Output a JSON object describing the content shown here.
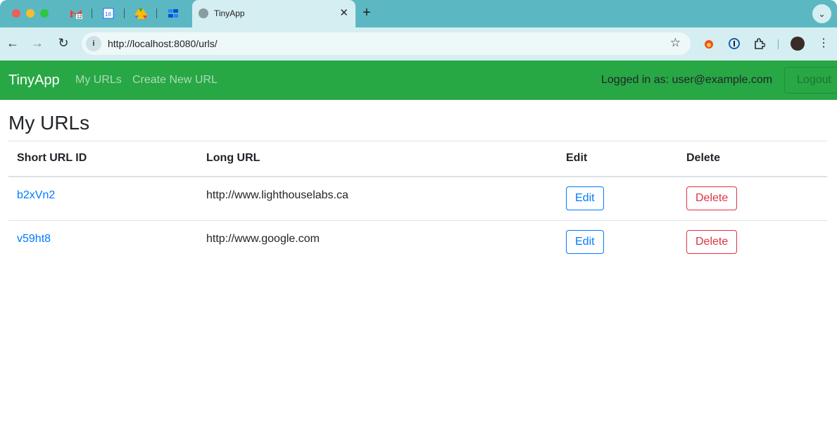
{
  "browser": {
    "active_tab_title": "TinyApp",
    "url": "http://localhost:8080/urls/",
    "pinned_tabs": [
      {
        "icon": "gmail-icon",
        "badge": "12"
      },
      {
        "icon": "calendar-icon",
        "badge": "16"
      },
      {
        "icon": "drive-icon"
      },
      {
        "icon": "jira-icon"
      }
    ]
  },
  "navbar": {
    "brand": "TinyApp",
    "links": [
      "My URLs",
      "Create New URL"
    ],
    "logged_in_text": "Logged in as: user@example.com",
    "logout_label": "Logout",
    "color": "#28a745"
  },
  "page": {
    "title": "My URLs",
    "table": {
      "headers": [
        "Short URL ID",
        "Long URL",
        "Edit",
        "Delete"
      ],
      "rows": [
        {
          "short_id": "b2xVn2",
          "long_url": "http://www.lighthouselabs.ca",
          "edit_label": "Edit",
          "delete_label": "Delete"
        },
        {
          "short_id": "v59ht8",
          "long_url": "http://www.google.com",
          "edit_label": "Edit",
          "delete_label": "Delete"
        }
      ]
    }
  }
}
